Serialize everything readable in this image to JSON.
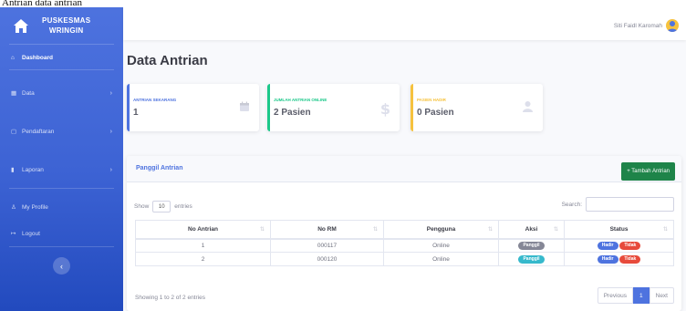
{
  "window": {
    "title": "Antrian data antrian"
  },
  "colors": {
    "primary": "#4e73df",
    "success": "#1e8449",
    "warning": "#f6c23e",
    "danger": "#e74a3b",
    "info": "#36b9cc",
    "secondary": "#858796"
  },
  "sidebar": {
    "brand_line1": "PUSKESMAS",
    "brand_line2": "WRINGIN",
    "brand_icon": "house-icon",
    "items": [
      {
        "label": "Dashboard",
        "icon": "home-icon",
        "active": true,
        "caret": ""
      },
      {
        "label": "Data",
        "icon": "grid-icon",
        "active": false,
        "caret": "›"
      },
      {
        "label": "Pendaftaran",
        "icon": "form-icon",
        "active": false,
        "caret": "›"
      },
      {
        "label": "Laporan",
        "icon": "chart-icon",
        "active": false,
        "caret": "›"
      },
      {
        "label": "My Profile",
        "icon": "user-icon",
        "active": false,
        "caret": ""
      },
      {
        "label": "Logout",
        "icon": "logout-icon",
        "active": false,
        "caret": ""
      }
    ],
    "collapse_glyph": "‹"
  },
  "topbar": {
    "user_name": "Siti Faidl Karomah"
  },
  "page": {
    "title": "Data Antrian"
  },
  "cards": [
    {
      "label": "ANTRIAN SEKARANG",
      "value": "1",
      "icon": "calendar-icon",
      "color": "#4e73df"
    },
    {
      "label": "JUMLAH ANTRIAN ONLINE",
      "value": "2 Pasien",
      "icon": "dollar-icon",
      "color": "#1cc88a"
    },
    {
      "label": "PASIEN HADIR",
      "value": "0 Pasien",
      "icon": "user-icon",
      "color": "#f6c23e"
    }
  ],
  "panel": {
    "title": "Panggil Antrian",
    "add_button": "+ Tambah Antrian",
    "show_label": "Show",
    "show_value": "10",
    "entries_label": "entries",
    "search_label": "Search:",
    "search_placeholder": "",
    "columns": [
      "No Antrian",
      "No RM",
      "Pengguna",
      "Aksi",
      "Status"
    ],
    "rows": [
      {
        "no_antrian": "1",
        "no_rm": "000117",
        "pengguna": "Online",
        "aksi": "Panggil",
        "status": [
          "Hadir",
          "Tidak"
        ]
      },
      {
        "no_antrian": "2",
        "no_rm": "000120",
        "pengguna": "Online",
        "aksi": "Panggil",
        "status": [
          "Hadir",
          "Tidak"
        ]
      }
    ],
    "info": "Showing 1 to 2 of 2 entries",
    "pager": {
      "previous": "Previous",
      "current": "1",
      "next": "Next"
    }
  }
}
